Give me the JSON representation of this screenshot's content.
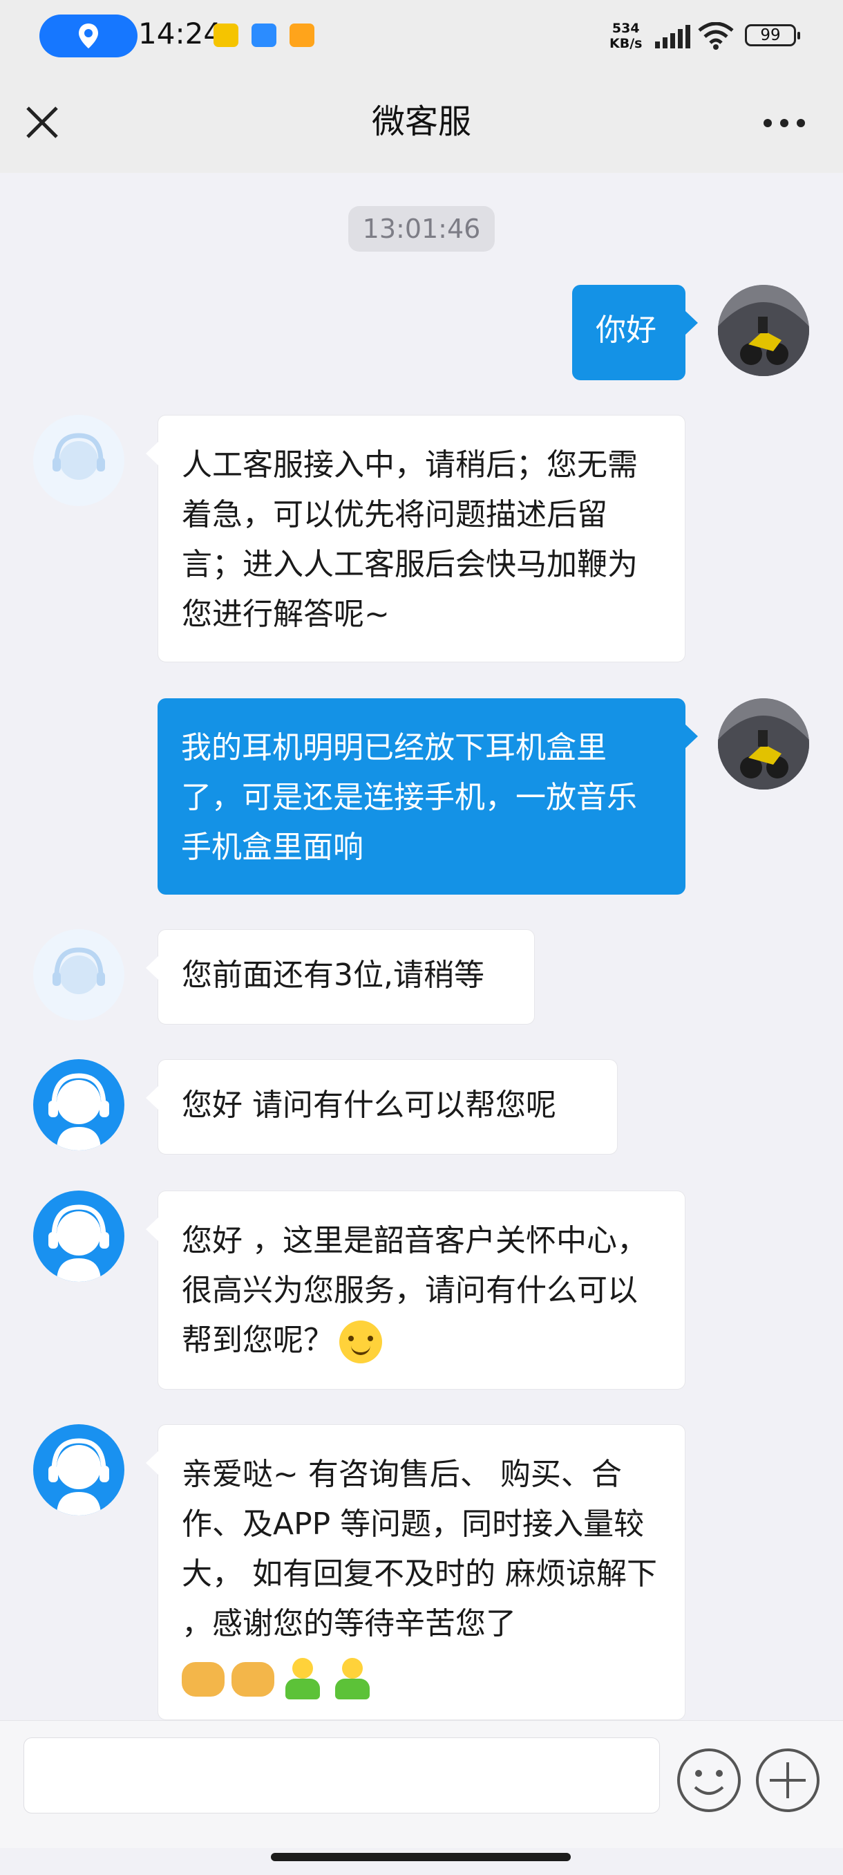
{
  "status_bar": {
    "time": "14:24",
    "net_speed_value": "534",
    "net_speed_unit": "KB/s",
    "battery": "99"
  },
  "nav": {
    "title": "微客服",
    "close_icon": "close-icon",
    "more_icon": "more-icon"
  },
  "chat": {
    "timestamp": "13:01:46",
    "messages": [
      {
        "from": "user",
        "text": "你好"
      },
      {
        "from": "agent",
        "text": "人工客服接入中，请稍后；您无需着急，可以优先将问题描述后留言；进入人工客服后会快马加鞭为您进行解答呢~"
      },
      {
        "from": "user",
        "text": "我的耳机明明已经放下耳机盒里了，可是还是连接手机，一放音乐手机盒里面响"
      },
      {
        "from": "agent",
        "text": "您前面还有3位,请稍等"
      },
      {
        "from": "agent",
        "text": "您好 请问有什么可以帮您呢"
      },
      {
        "from": "agent",
        "text": "您好 ，这里是韶音客户关怀中心，很高兴为您服务，请问有什么可以帮到您呢？"
      },
      {
        "from": "agent",
        "text": "亲爱哒~ 有咨询售后、 购买、合作、及APP 等问题，同时接入量较大， 如有回复不及时的 麻烦谅解下 ，感谢您的等待辛苦您了"
      }
    ]
  },
  "input": {
    "value": "",
    "placeholder": ""
  },
  "colors": {
    "accent": "#1492e6",
    "page_bg": "#f1f1f6",
    "header_bg": "#ededed"
  }
}
